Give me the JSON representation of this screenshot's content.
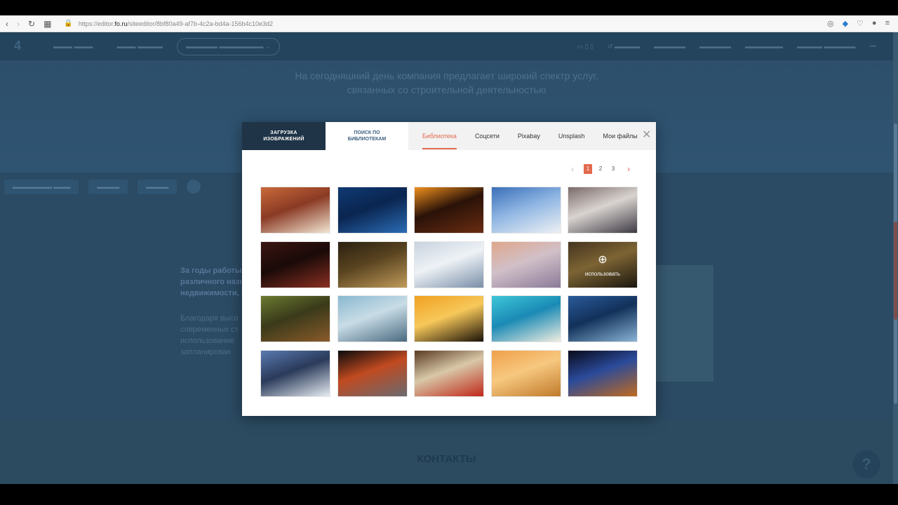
{
  "browser": {
    "url_prefix": "https://editor.",
    "url_domain": "fo.ru",
    "url_suffix": "/siteeditor/8bf80a49-af7b-4c2a-bd4a-156b4c10e3d2"
  },
  "modal": {
    "tab_upload": "ЗАГРУЗКА ИЗОБРАЖЕНИЙ",
    "tab_search": "ПОИСК ПО БИБЛИОТЕКАМ",
    "subtabs": [
      "Библиотека",
      "Соцсети",
      "Pixabay",
      "Unsplash",
      "Мои файлы"
    ],
    "active_subtab": "Библиотека",
    "pages": [
      "1",
      "2",
      "3"
    ],
    "active_page": "1",
    "hover_action": "использовать",
    "images": [
      {
        "name": "sausage-image",
        "colors": [
          "#c96a3a",
          "#f2e6d3",
          "#8a3a24"
        ]
      },
      {
        "name": "lighthouse-image",
        "colors": [
          "#0f3a73",
          "#2b6cb5",
          "#0a2550"
        ]
      },
      {
        "name": "fire-ice-image",
        "colors": [
          "#f0901e",
          "#6a2c12",
          "#2a1208"
        ]
      },
      {
        "name": "white-dog-image",
        "colors": [
          "#3a6fb8",
          "#eef1f4",
          "#8db4e2"
        ]
      },
      {
        "name": "castle-image",
        "colors": [
          "#7a6a6a",
          "#3e3a44",
          "#d9d4d0"
        ]
      },
      {
        "name": "old-man-image",
        "colors": [
          "#3a1512",
          "#8a2f22",
          "#1a0a08"
        ]
      },
      {
        "name": "wine-bottles-image",
        "colors": [
          "#2a2010",
          "#c09a5a",
          "#5a4420"
        ]
      },
      {
        "name": "snow-skier-image",
        "colors": [
          "#c8d2de",
          "#7a8ea8",
          "#eef2f6"
        ]
      },
      {
        "name": "lake-sunset-image",
        "colors": [
          "#e0a68c",
          "#8b7a98",
          "#d1c0c8"
        ]
      },
      {
        "name": "bridge-night-image",
        "colors": [
          "#6a5030",
          "#2a2418",
          "#c09a50"
        ]
      },
      {
        "name": "owl-image",
        "colors": [
          "#6a7a30",
          "#8a5a2a",
          "#3a3a1a"
        ]
      },
      {
        "name": "pier-image",
        "colors": [
          "#8ab8d0",
          "#4a6a80",
          "#c8dce6"
        ]
      },
      {
        "name": "acacia-sunset-image",
        "colors": [
          "#f0a020",
          "#1a1208",
          "#f7c85a"
        ]
      },
      {
        "name": "beach-image",
        "colors": [
          "#3ec6d8",
          "#f0ede0",
          "#1a8ab5"
        ]
      },
      {
        "name": "fish-image",
        "colors": [
          "#2a5a9a",
          "#8ab4d6",
          "#12315a"
        ]
      },
      {
        "name": "mountain-image",
        "colors": [
          "#5a7ab0",
          "#e6ecf2",
          "#2a3a5a"
        ]
      },
      {
        "name": "smoke-match-image",
        "colors": [
          "#0a0a0c",
          "#6a6a70",
          "#c04a20"
        ]
      },
      {
        "name": "tomatoes-board-image",
        "colors": [
          "#5a3a22",
          "#c0281a",
          "#d8c8a8"
        ]
      },
      {
        "name": "boat-sunset-image",
        "colors": [
          "#f0a04a",
          "#c07a2a",
          "#f7c880"
        ]
      },
      {
        "name": "city-bridge-night-image",
        "colors": [
          "#0a0a1a",
          "#c06a20",
          "#2a4a9a"
        ]
      }
    ]
  },
  "background": {
    "hero_line1": "На сегодняшний день компания предлагает широкий спектр услуг,",
    "hero_line2": "связанных со строительной деятельностью",
    "side_text_bold": "За годы работы с различного назн недвижимости, з",
    "side_text_normal": "Благодаря высо современных ст использование запланирован",
    "contacts": "КОНТАКТЫ"
  }
}
